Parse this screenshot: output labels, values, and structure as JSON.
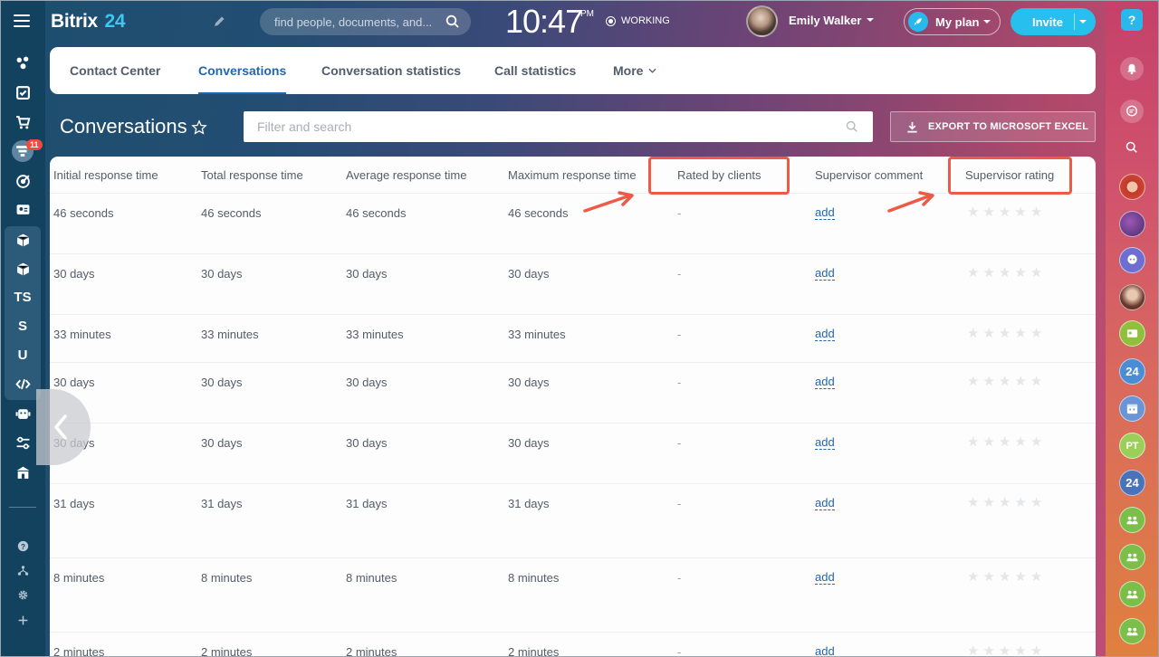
{
  "header": {
    "logo_text": "Bitrix",
    "logo_num": "24",
    "search_placeholder": "find people, documents, and...",
    "clock": "10:47",
    "clock_suffix": "PM",
    "work_status": "WORKING",
    "user_name": "Emily Walker",
    "plan_label": "My plan",
    "invite_label": "Invite"
  },
  "left_sidebar": {
    "notification_badge": "11",
    "letter_items": [
      "TS",
      "S",
      "U"
    ]
  },
  "tabs": [
    {
      "label": "Contact Center",
      "active": false
    },
    {
      "label": "Conversations",
      "active": true
    },
    {
      "label": "Conversation statistics",
      "active": false
    },
    {
      "label": "Call statistics",
      "active": false
    },
    {
      "label": "More",
      "active": false
    }
  ],
  "page": {
    "title": "Conversations",
    "filter_placeholder": "Filter and search",
    "export_label": "EXPORT TO MICROSOFT EXCEL"
  },
  "table": {
    "columns": [
      "Initial response time",
      "Total response time",
      "Average response time",
      "Maximum response time",
      "Rated by clients",
      "Supervisor comment",
      "Supervisor rating"
    ],
    "rows": [
      [
        "46 seconds",
        "46 seconds",
        "46 seconds",
        "46 seconds",
        "-",
        "add"
      ],
      [
        "30 days",
        "30 days",
        "30 days",
        "30 days",
        "-",
        "add"
      ],
      [
        "33 minutes",
        "33 minutes",
        "33 minutes",
        "33 minutes",
        "-",
        "add"
      ],
      [
        "30 days",
        "30 days",
        "30 days",
        "30 days",
        "-",
        "add"
      ],
      [
        "30 days",
        "30 days",
        "30 days",
        "30 days",
        "-",
        "add"
      ],
      [
        "31 days",
        "31 days",
        "31 days",
        "31 days",
        "-",
        "add"
      ],
      [
        "8 minutes",
        "8 minutes",
        "8 minutes",
        "8 minutes",
        "-",
        "add"
      ],
      [
        "2 minutes",
        "2 minutes",
        "2 minutes",
        "2 minutes",
        "-",
        "add"
      ]
    ],
    "rating_max": 5
  },
  "right_sidebar": {
    "help_label": "?",
    "avatar_labels": [
      "24",
      "PT",
      "24"
    ]
  },
  "colors": {
    "accent_blue": "#2067b0",
    "highlight_red": "#ee5a48",
    "invite_blue": "#25c0ee"
  }
}
